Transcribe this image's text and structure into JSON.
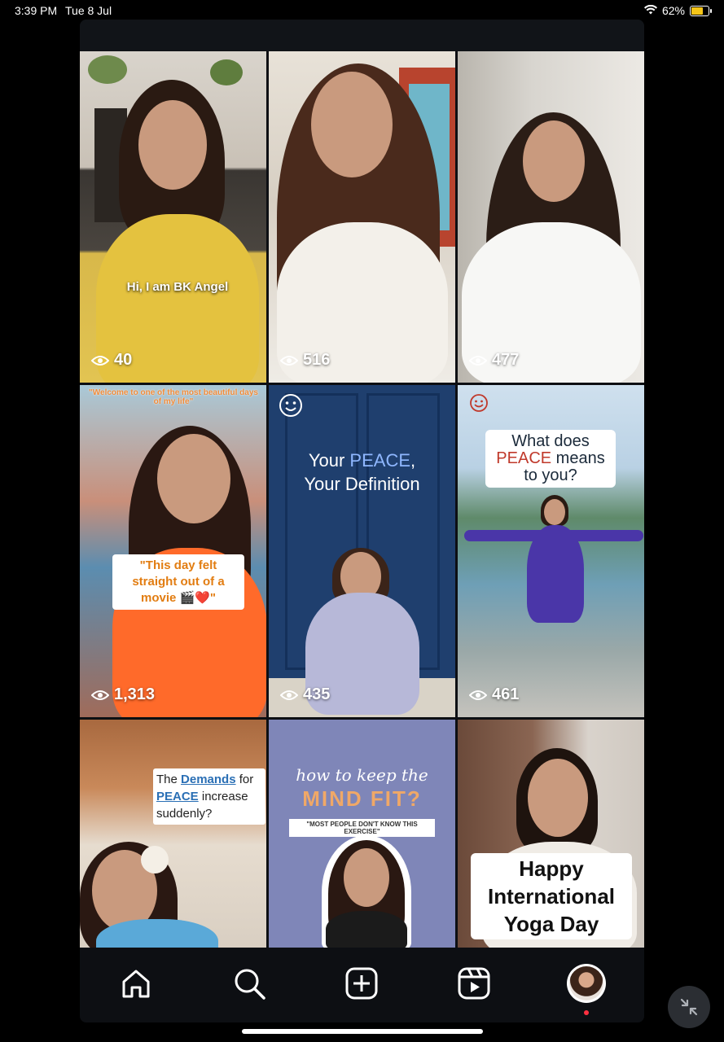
{
  "status_bar": {
    "time": "3:39 PM",
    "date": "Tue 8 Jul",
    "battery": "62%"
  },
  "grid": {
    "tiles": [
      {
        "caption": "Hi, I am BK Angel",
        "views": "40"
      },
      {
        "caption": "",
        "views": "516"
      },
      {
        "caption": "",
        "views": "477"
      },
      {
        "caption_top": "\"Welcome to one of the most beautiful days of my life\"",
        "caption": "\"This day felt straight out of a movie 🎬❤️\"",
        "views": "1,313"
      },
      {
        "caption_line1_a": "Your ",
        "caption_line1_b": "PEACE",
        "caption_line1_c": ",",
        "caption_line2": "Your Definition",
        "views": "435"
      },
      {
        "caption_line1": "What does",
        "caption_line2_a": "PEACE",
        "caption_line2_b": " means",
        "caption_line3": "to you?",
        "views": "461"
      },
      {
        "caption_a": "The ",
        "caption_b": "Demands",
        "caption_c": " for",
        "caption_d": "PEACE",
        "caption_e": " increase",
        "caption_f": "suddenly?"
      },
      {
        "caption_line1": "how to keep the",
        "caption_line2": "MIND FIT?",
        "caption_line3": "\"MOST PEOPLE DON'T KNOW THIS EXERCISE\""
      },
      {
        "caption_line1": "Happy",
        "caption_line2": "International",
        "caption_line3": "Yoga Day"
      }
    ]
  },
  "bottom_nav": {
    "items": [
      "home-icon",
      "search-icon",
      "create-icon",
      "reels-icon",
      "profile-avatar"
    ]
  },
  "colors": {
    "accent_peace": "#5b9bd5",
    "notif": "#ff3040",
    "battery": "#f5c518"
  }
}
